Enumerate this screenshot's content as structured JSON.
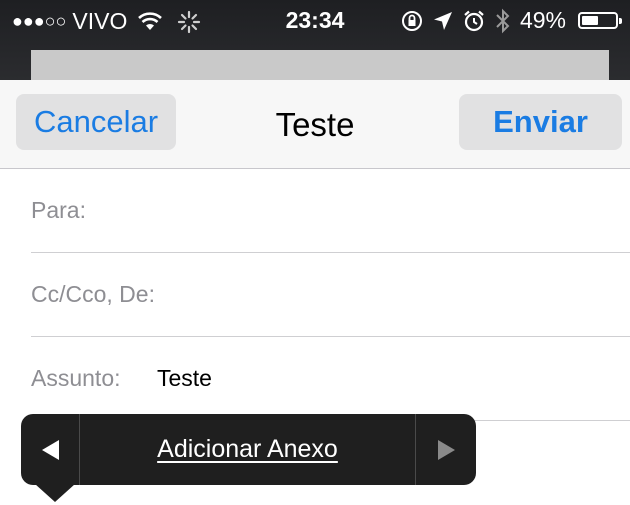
{
  "status_bar": {
    "signal": "●●●○○",
    "carrier": "VIVO",
    "time": "23:34",
    "battery_text": "49%",
    "battery_level": 0.49
  },
  "nav": {
    "cancel_label": "Cancelar",
    "title": "Teste",
    "send_label": "Enviar"
  },
  "fields": {
    "to_label": "Para:",
    "to_value": "",
    "cc_label": "Cc/Cco, De:",
    "subject_label": "Assunto:",
    "subject_value": "Teste"
  },
  "edit_menu": {
    "item_label": "Adicionar Anexo"
  },
  "colors": {
    "accent": "#1a7ce3",
    "status_bar_bg": "#1e1f22",
    "menu_bg": "#1f1f1f"
  }
}
